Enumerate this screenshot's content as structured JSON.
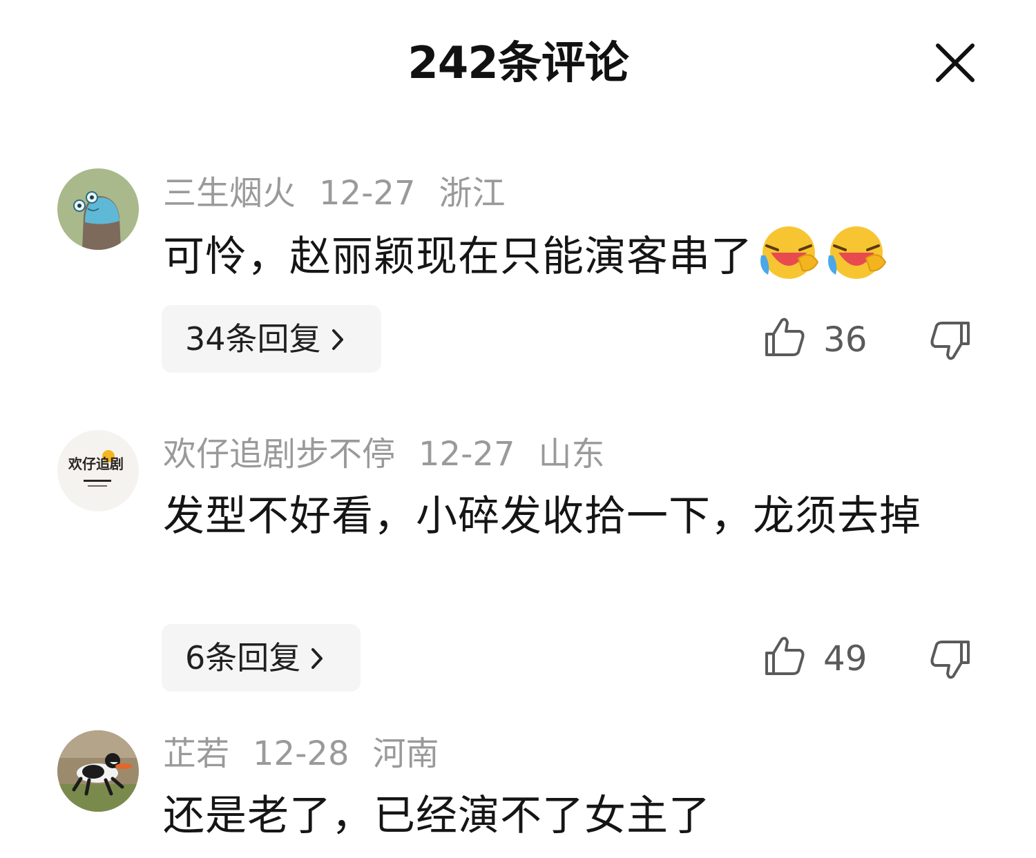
{
  "header": {
    "title": "242条评论",
    "close_icon": "close-icon"
  },
  "comments": [
    {
      "username": "三生烟火",
      "date": "12-27",
      "location": "浙江",
      "text": "可怜，赵丽颖现在只能演客串了",
      "emojis": [
        "laughing-crying-emoji",
        "laughing-crying-emoji"
      ],
      "replies": "34条回复",
      "likes": "36"
    },
    {
      "username": "欢仔追剧步不停",
      "date": "12-27",
      "location": "山东",
      "text": "发型不好看，小碎发收拾一下，龙须去掉",
      "avatar_text": "欢仔追剧",
      "replies": "6条回复",
      "likes": "49"
    },
    {
      "username": "芷若",
      "date": "12-28",
      "location": "河南",
      "text": "还是老了，已经演不了女主了"
    }
  ],
  "colors": {
    "text_primary": "#151515",
    "text_meta": "#9a9a9a",
    "reply_bg": "#f5f5f5",
    "count_text": "#5a5a5a"
  }
}
